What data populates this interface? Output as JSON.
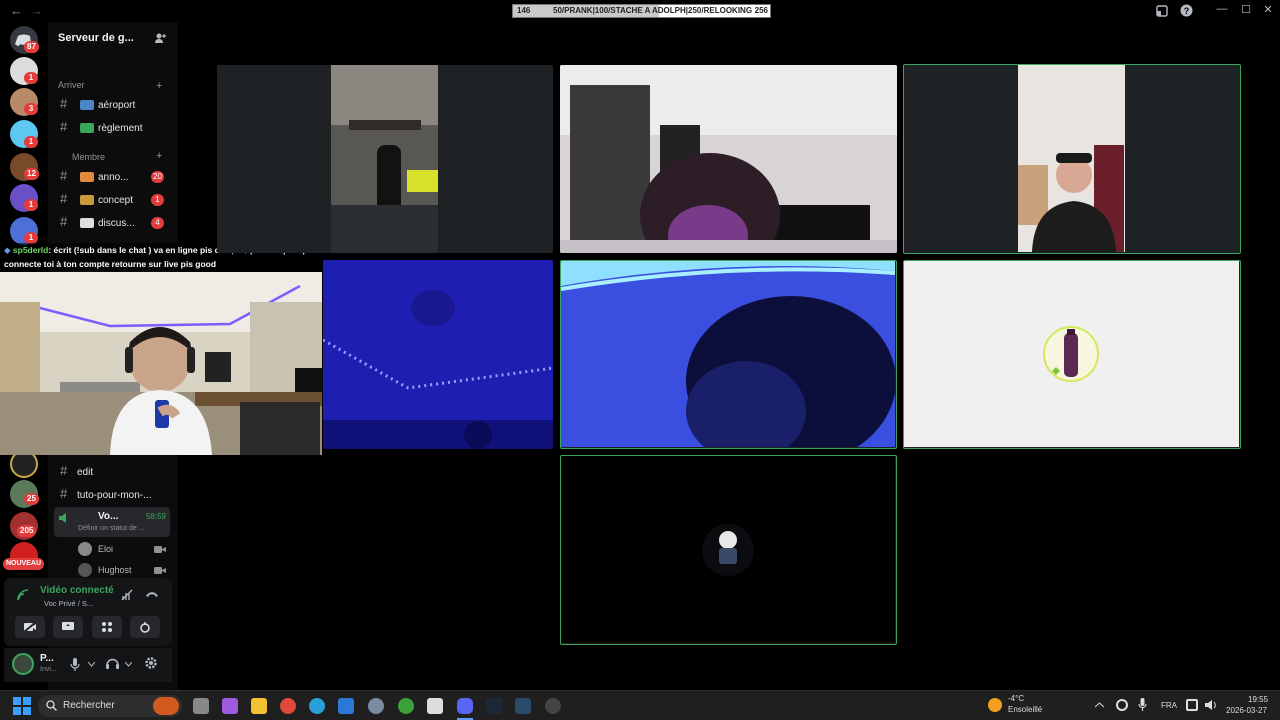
{
  "titlebar": {
    "back": "←",
    "forward": "→",
    "goal": {
      "left": "146",
      "middle": "50/PRANK|100/STACHE A ADOLPH|250/RELOOKING",
      "right": "256",
      "progress": 0.57
    },
    "icons": [
      "inbox-icon",
      "help-icon"
    ],
    "window": {
      "minimize": "—",
      "maximize": "☐",
      "close": "✕"
    }
  },
  "guilds": {
    "badges": [
      "87",
      "1",
      "3",
      "1",
      "12",
      "1",
      "1",
      "25",
      "205",
      "NOUVEAU"
    ]
  },
  "sidebar": {
    "server_name": "Serveur de g...",
    "categories": {
      "arriver": "Arriver",
      "membre": "Membre"
    },
    "channels": [
      {
        "name": "aéroport",
        "badge": ""
      },
      {
        "name": "règlement",
        "badge": ""
      },
      {
        "name": "anno...",
        "badge": "20"
      },
      {
        "name": "concept",
        "badge": "1"
      },
      {
        "name": "discus...",
        "badge": "4"
      },
      {
        "name": "edit",
        "badge": ""
      },
      {
        "name": "tuto-pour-mon-...",
        "badge": ""
      }
    ],
    "voice_channel": {
      "name": "Vo...",
      "timer": "58:59",
      "status": "Définir un statut de ..."
    },
    "voice_users": [
      "Eloi",
      "Hughost"
    ]
  },
  "overlay_chat": {
    "user": "sp5derld",
    "line1": ": écrit (!sub dans le chat ) va en ligne pis c 49,90$ pour 10 pis après",
    "line2": "connecte toi à ton compte retourne sur live pis good"
  },
  "voice_status": {
    "title": "Vidéo connecté",
    "subtitle": "Voc Privé / S..."
  },
  "user_panel": {
    "name": "P...",
    "status": "Invi..."
  },
  "taskbar": {
    "search": "Rechercher",
    "weather_temp": "-4°C",
    "weather_desc": "Ensoleillé",
    "language": "FRA",
    "time": "19:55",
    "date": "2026-03-27"
  },
  "colors": {
    "speaking": "#3ba55d",
    "badge": "#e23c3c",
    "voice_green": "#3ba55d"
  }
}
